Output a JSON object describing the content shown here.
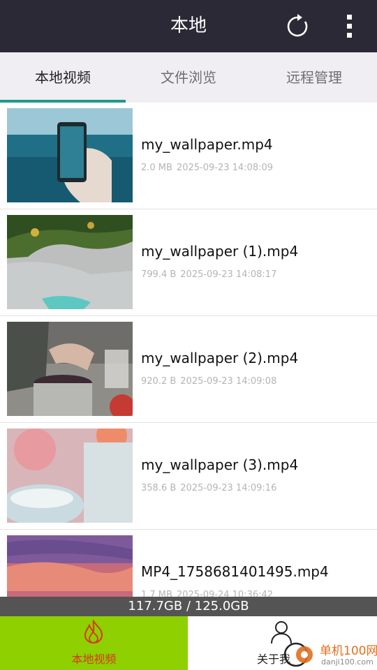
{
  "appbar": {
    "title": "本地",
    "refresh_icon": "refresh-icon",
    "more_icon": "more-vert-icon"
  },
  "tabs": [
    {
      "label": "本地视频",
      "active": true
    },
    {
      "label": "文件浏览",
      "active": false
    },
    {
      "label": "远程管理",
      "active": false
    }
  ],
  "videos": [
    {
      "name": "my_wallpaper.mp4",
      "size": "2.0 MB",
      "date": "2025-09-23 14:08:09"
    },
    {
      "name": "my_wallpaper (1).mp4",
      "size": "799.4 B",
      "date": "2025-09-23 14:08:17"
    },
    {
      "name": "my_wallpaper (2).mp4",
      "size": "920.2 B",
      "date": "2025-09-23 14:09:08"
    },
    {
      "name": "my_wallpaper (3).mp4",
      "size": "358.6 B",
      "date": "2025-09-23 14:09:16"
    },
    {
      "name": "MP4_1758681401495.mp4",
      "size": "1.7 MB",
      "date": "2025-09-24 10:36:42"
    }
  ],
  "storage": {
    "text": "117.7GB / 125.0GB"
  },
  "bottom_nav": [
    {
      "label": "本地视频",
      "icon": "flame-icon",
      "active": true
    },
    {
      "label": "关于我",
      "icon": "user-icon",
      "active": false
    }
  ],
  "watermark": {
    "brand": "单机100网",
    "domain": "danji100.com"
  },
  "colors": {
    "appbar": "#2b2936",
    "tab_indicator": "#1e9a8a",
    "nav_active": "#8ed000",
    "nav_active_text": "#d9361b"
  }
}
